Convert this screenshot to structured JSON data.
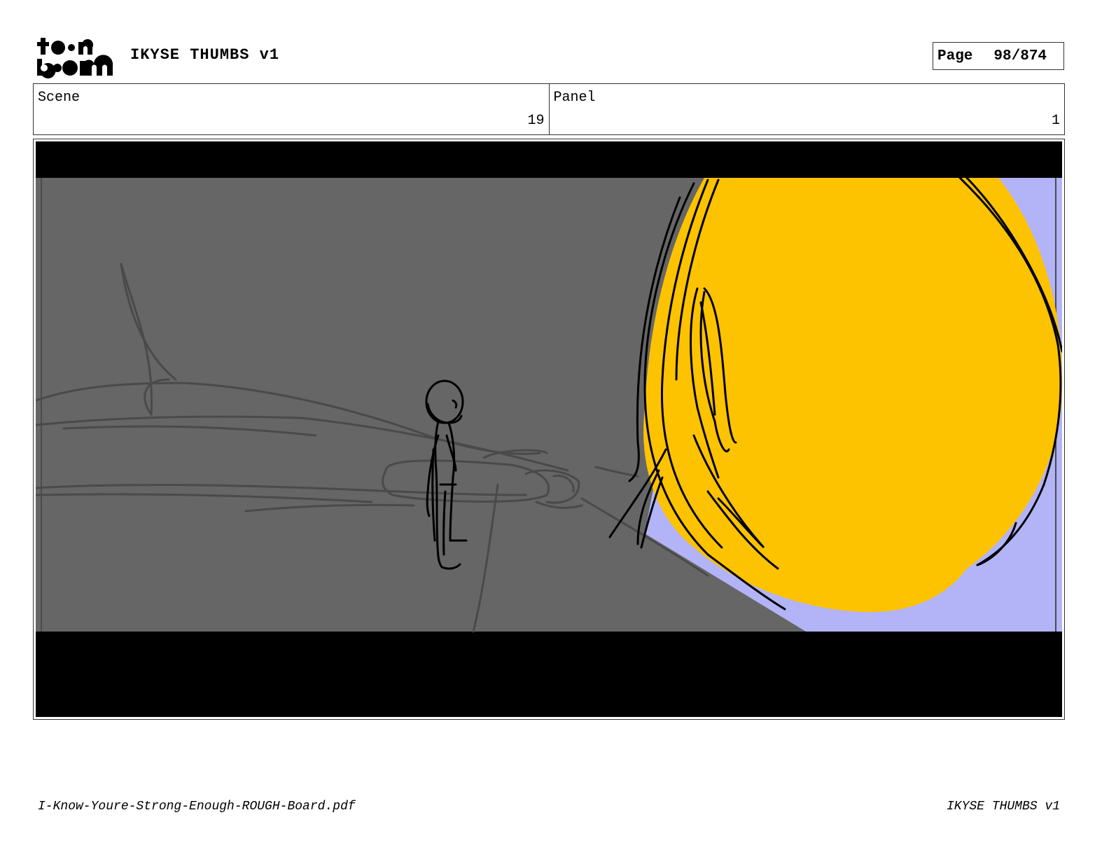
{
  "header": {
    "logo": {
      "text_top": "toon",
      "text_bottom": "boom"
    },
    "title": "IKYSE THUMBS v1",
    "page_label": "Page",
    "page_value": "98/874"
  },
  "info": {
    "scene_label": "Scene",
    "scene_value": "19",
    "panel_label": "Panel",
    "panel_value": "1"
  },
  "panel_art": {
    "colors": {
      "letterbox": "#000000",
      "background": "#666666",
      "sketch_lines": "#4a4a4a",
      "creature_fill": "#FDC300",
      "sky_accent": "#B3B3F7",
      "ink": "#000000"
    }
  },
  "footer": {
    "filename": "I-Know-Youre-Strong-Enough-ROUGH-Board.pdf",
    "title": "IKYSE THUMBS v1"
  }
}
